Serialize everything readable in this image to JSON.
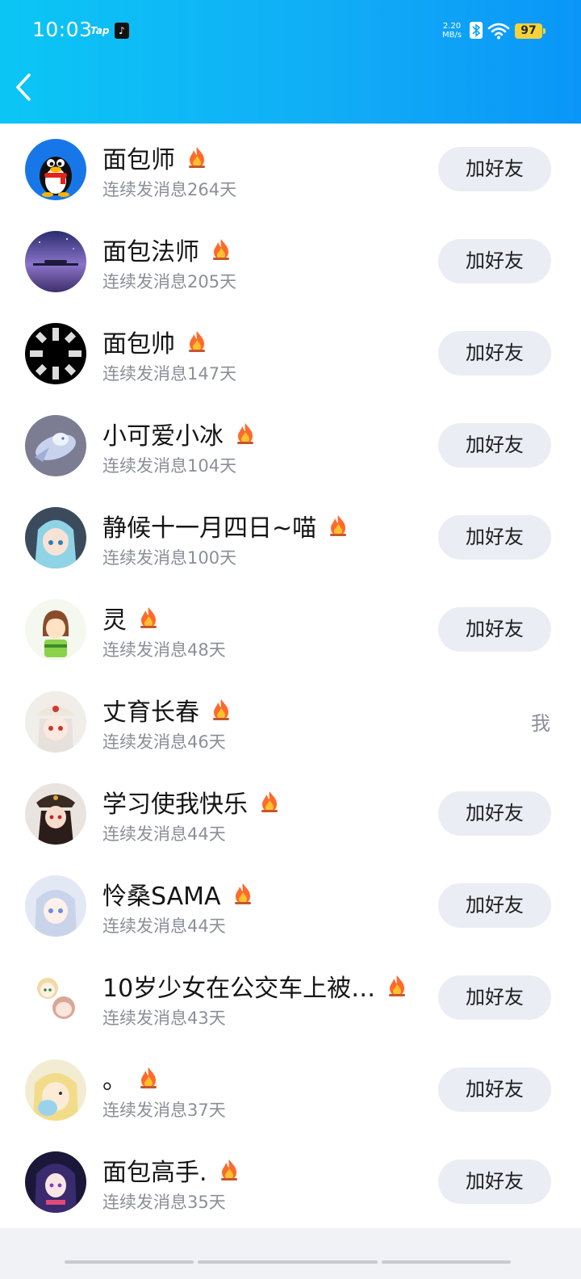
{
  "status_bar": {
    "time": "10:03",
    "tap_label": "Tap",
    "net_speed_value": "2.20",
    "net_speed_unit": "MB/s",
    "battery": "97",
    "icons": [
      "tap-icon",
      "tiktok-icon",
      "bluetooth-icon",
      "wifi-icon",
      "battery-icon"
    ]
  },
  "header": {
    "back_icon": "chevron-left-icon",
    "colors": {
      "gradient_start": "#0bc6f5",
      "gradient_end": "#0a96f8"
    }
  },
  "rows": [
    {
      "name": "面包师",
      "streak": "连续发消息264天",
      "action": "加好友",
      "avatar": "qq-penguin"
    },
    {
      "name": "面包法师",
      "streak": "连续发消息205天",
      "action": "加好友",
      "avatar": "night-sky"
    },
    {
      "name": "面包帅",
      "streak": "连续发消息147天",
      "action": "加好友",
      "avatar": "loading-wheel"
    },
    {
      "name": "小可爱小冰",
      "streak": "连续发消息104天",
      "action": "加好友",
      "avatar": "white-dragon"
    },
    {
      "name": "静候十一月四日~喵",
      "streak": "连续发消息100天",
      "action": "加好友",
      "avatar": "blue-hair-girl"
    },
    {
      "name": "灵",
      "streak": "连续发消息48天",
      "action": "加好友",
      "avatar": "brown-hair-kid"
    },
    {
      "name": "丈育长春",
      "streak": "连续发消息46天",
      "action": "我",
      "avatar": "white-hair-girl-cap"
    },
    {
      "name": "学习使我快乐",
      "streak": "连续发消息44天",
      "action": "加好友",
      "avatar": "dark-hair-uniform"
    },
    {
      "name": "怜桑SAMA",
      "streak": "连续发消息44天",
      "action": "加好友",
      "avatar": "silver-hair-girl"
    },
    {
      "name": "10岁少女在公交车上被…",
      "streak": "连续发消息43天",
      "action": "加好友",
      "avatar": "chibi-pair"
    },
    {
      "name": "。",
      "streak": "连续发消息37天",
      "action": "加好友",
      "avatar": "blonde-girl"
    },
    {
      "name": "面包高手.",
      "streak": "连续发消息35天",
      "action": "加好友",
      "avatar": "purple-hair-boy"
    }
  ],
  "colors": {
    "button_bg": "#eaedf4",
    "subtext": "#8b8f99",
    "fire": "#ff6a2b"
  }
}
